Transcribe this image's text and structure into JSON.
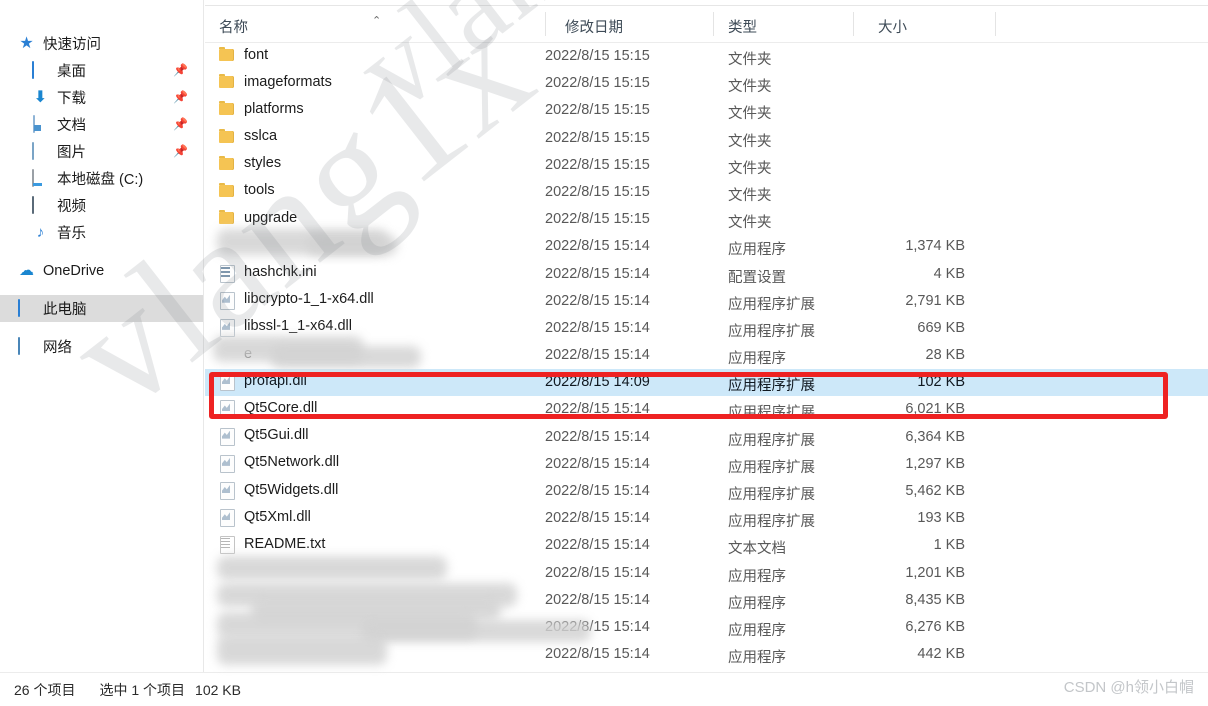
{
  "window": {
    "watermark_text": "vlang1x",
    "credit": "CSDN @h领小白帽"
  },
  "sidebar": {
    "items": [
      {
        "label": "快速访问",
        "icon": "star-icon",
        "indent": false,
        "pinned": false,
        "selected": false
      },
      {
        "label": "桌面",
        "icon": "desktop-icon",
        "indent": true,
        "pinned": true,
        "selected": false
      },
      {
        "label": "下载",
        "icon": "download-icon",
        "indent": true,
        "pinned": true,
        "selected": false
      },
      {
        "label": "文档",
        "icon": "document-icon",
        "indent": true,
        "pinned": true,
        "selected": false
      },
      {
        "label": "图片",
        "icon": "pictures-icon",
        "indent": true,
        "pinned": true,
        "selected": false
      },
      {
        "label": "本地磁盘 (C:)",
        "icon": "local-disk-icon",
        "indent": true,
        "pinned": false,
        "selected": false
      },
      {
        "label": "视频",
        "icon": "video-icon",
        "indent": true,
        "pinned": false,
        "selected": false
      },
      {
        "label": "音乐",
        "icon": "music-icon",
        "indent": true,
        "pinned": false,
        "selected": false
      },
      {
        "label": "OneDrive",
        "icon": "cloud-icon",
        "indent": false,
        "pinned": false,
        "selected": false
      },
      {
        "label": "此电脑",
        "icon": "this-pc-icon",
        "indent": false,
        "pinned": false,
        "selected": true
      },
      {
        "label": "网络",
        "icon": "network-icon",
        "indent": false,
        "pinned": false,
        "selected": false
      }
    ],
    "pin_glyph": "📌"
  },
  "columns": {
    "name": "名称",
    "date": "修改日期",
    "type": "类型",
    "size": "大小",
    "sort_indicator": "⌃",
    "sorted_by": "名称",
    "sort_direction": "ascending"
  },
  "files": [
    {
      "name": "font",
      "icon": "folder-icon",
      "date": "2022/8/15 15:15",
      "type": "文件夹",
      "size": "",
      "redacted": false,
      "selected": false
    },
    {
      "name": "imageformats",
      "icon": "folder-icon",
      "date": "2022/8/15 15:15",
      "type": "文件夹",
      "size": "",
      "redacted": false,
      "selected": false
    },
    {
      "name": "platforms",
      "icon": "folder-icon",
      "date": "2022/8/15 15:15",
      "type": "文件夹",
      "size": "",
      "redacted": false,
      "selected": false
    },
    {
      "name": "sslca",
      "icon": "folder-icon",
      "date": "2022/8/15 15:15",
      "type": "文件夹",
      "size": "",
      "redacted": false,
      "selected": false
    },
    {
      "name": "styles",
      "icon": "folder-icon",
      "date": "2022/8/15 15:15",
      "type": "文件夹",
      "size": "",
      "redacted": false,
      "selected": false
    },
    {
      "name": "tools",
      "icon": "folder-icon",
      "date": "2022/8/15 15:15",
      "type": "文件夹",
      "size": "",
      "redacted": false,
      "selected": false
    },
    {
      "name": "upgrade",
      "icon": "folder-icon",
      "date": "2022/8/15 15:15",
      "type": "文件夹",
      "size": "",
      "redacted": false,
      "selected": false
    },
    {
      "name": "",
      "icon": "app-icon",
      "date": "2022/8/15 15:14",
      "type": "应用程序",
      "size": "1,374 KB",
      "redacted": true,
      "selected": false
    },
    {
      "name": "hashchk.ini",
      "icon": "ini-icon",
      "date": "2022/8/15 15:14",
      "type": "配置设置",
      "size": "4 KB",
      "redacted": false,
      "selected": false
    },
    {
      "name": "libcrypto-1_1-x64.dll",
      "icon": "dll-icon",
      "date": "2022/8/15 15:14",
      "type": "应用程序扩展",
      "size": "2,791 KB",
      "redacted": false,
      "selected": false
    },
    {
      "name": "libssl-1_1-x64.dll",
      "icon": "dll-icon",
      "date": "2022/8/15 15:14",
      "type": "应用程序扩展",
      "size": "669 KB",
      "redacted": false,
      "selected": false
    },
    {
      "name": "e",
      "icon": "app-icon",
      "date": "2022/8/15 15:14",
      "type": "应用程序",
      "size": "28 KB",
      "redacted": true,
      "selected": false
    },
    {
      "name": "profapi.dll",
      "icon": "dll-icon",
      "date": "2022/8/15 14:09",
      "type": "应用程序扩展",
      "size": "102 KB",
      "redacted": false,
      "selected": true
    },
    {
      "name": "Qt5Core.dll",
      "icon": "dll-icon",
      "date": "2022/8/15 15:14",
      "type": "应用程序扩展",
      "size": "6,021 KB",
      "redacted": false,
      "selected": false
    },
    {
      "name": "Qt5Gui.dll",
      "icon": "dll-icon",
      "date": "2022/8/15 15:14",
      "type": "应用程序扩展",
      "size": "6,364 KB",
      "redacted": false,
      "selected": false
    },
    {
      "name": "Qt5Network.dll",
      "icon": "dll-icon",
      "date": "2022/8/15 15:14",
      "type": "应用程序扩展",
      "size": "1,297 KB",
      "redacted": false,
      "selected": false
    },
    {
      "name": "Qt5Widgets.dll",
      "icon": "dll-icon",
      "date": "2022/8/15 15:14",
      "type": "应用程序扩展",
      "size": "5,462 KB",
      "redacted": false,
      "selected": false
    },
    {
      "name": "Qt5Xml.dll",
      "icon": "dll-icon",
      "date": "2022/8/15 15:14",
      "type": "应用程序扩展",
      "size": "193 KB",
      "redacted": false,
      "selected": false
    },
    {
      "name": "README.txt",
      "icon": "txt-icon",
      "date": "2022/8/15 15:14",
      "type": "文本文档",
      "size": "1 KB",
      "redacted": false,
      "selected": false
    },
    {
      "name": "",
      "icon": "app-icon",
      "date": "2022/8/15 15:14",
      "type": "应用程序",
      "size": "1,201 KB",
      "redacted": true,
      "selected": false
    },
    {
      "name": "",
      "icon": "app-icon",
      "date": "2022/8/15 15:14",
      "type": "应用程序",
      "size": "8,435 KB",
      "redacted": true,
      "selected": false
    },
    {
      "name": "",
      "icon": "app-icon",
      "date": "2022/8/15 15:14",
      "type": "应用程序",
      "size": "6,276 KB",
      "redacted": true,
      "selected": false
    },
    {
      "name": "",
      "icon": "app-icon",
      "date": "2022/8/15 15:14",
      "type": "应用程序",
      "size": "442 KB",
      "redacted": true,
      "selected": false
    }
  ],
  "annotation": {
    "color": "#ee2222",
    "targets": "profapi.dll"
  },
  "statusbar": {
    "item_count": "26 个项目",
    "selected_count": "选中 1 个项目",
    "selected_size": "102 KB"
  }
}
